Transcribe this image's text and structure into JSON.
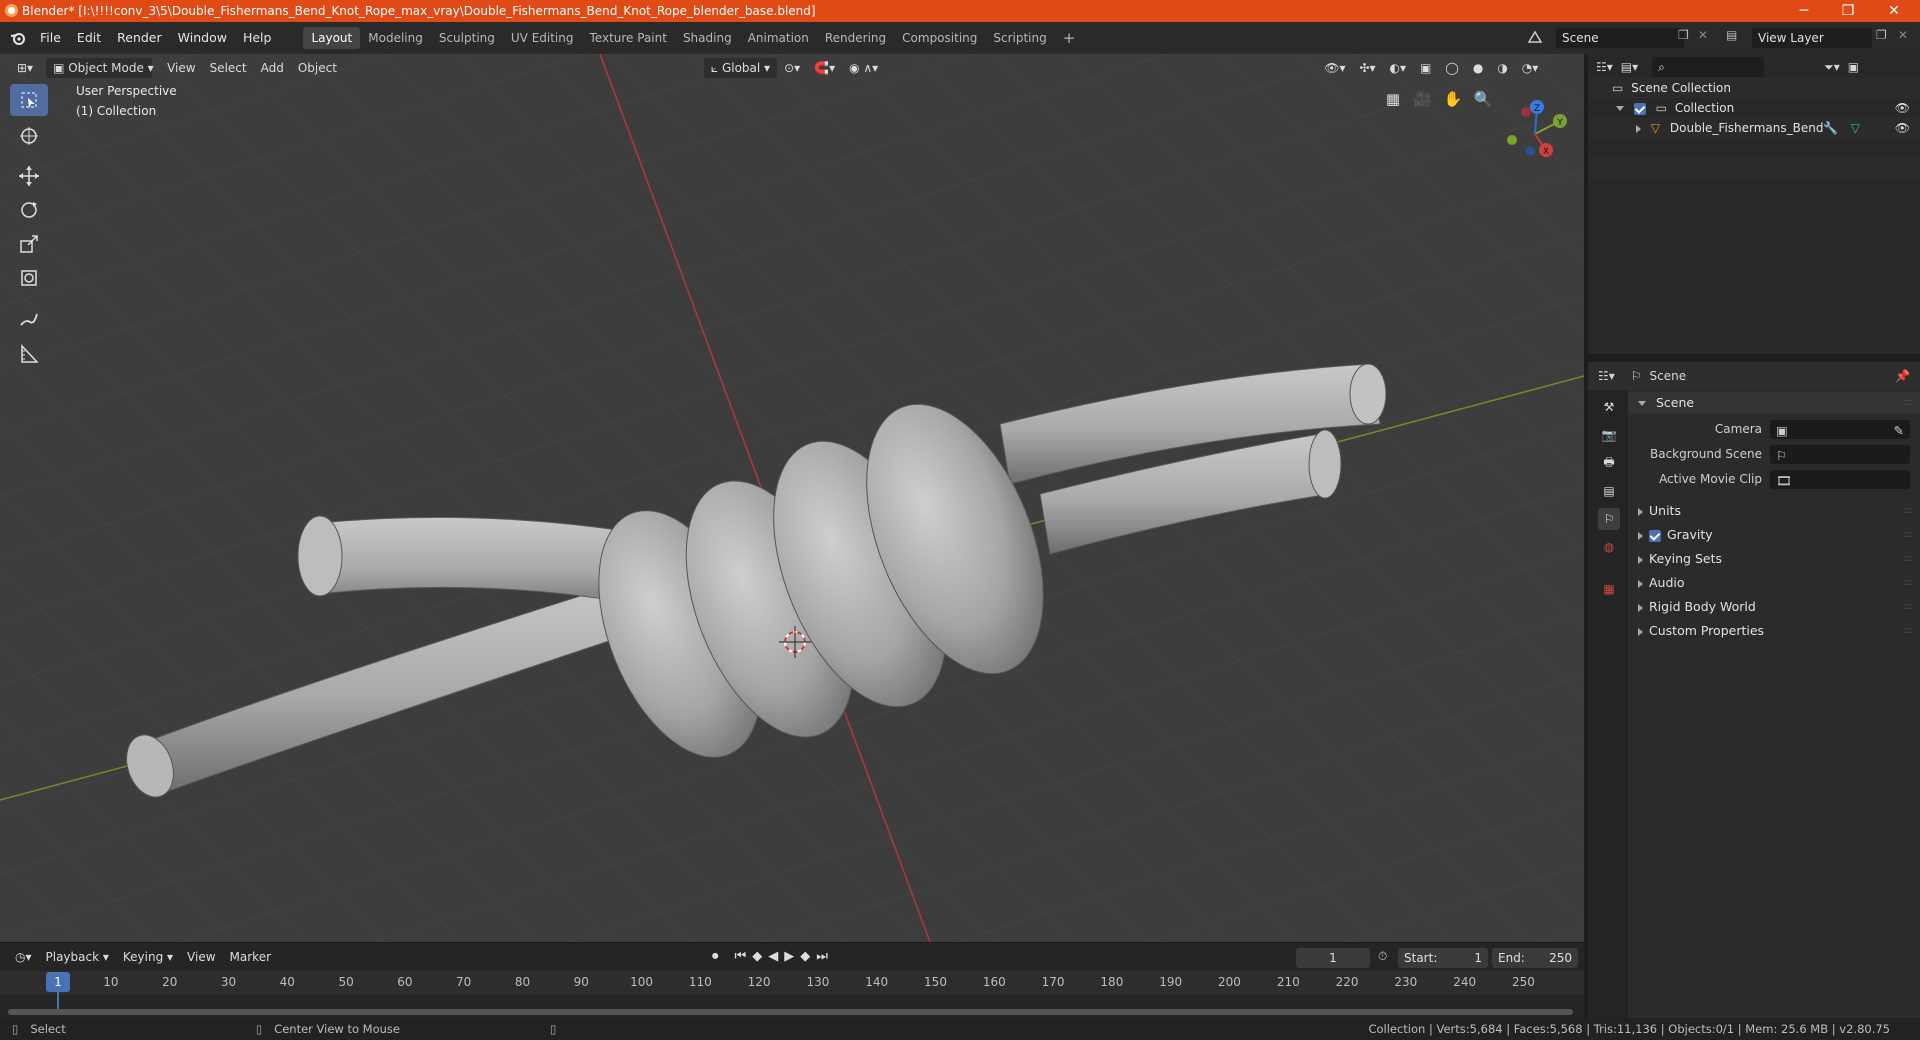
{
  "titlebar": {
    "title": "Blender* [I:\\!!!!conv_3\\5\\Double_Fishermans_Bend_Knot_Rope_max_vray\\Double_Fishermans_Bend_Knot_Rope_blender_base.blend]",
    "minimize": "─",
    "restore": "❐",
    "close": "✕"
  },
  "menu": [
    "File",
    "Edit",
    "Render",
    "Window",
    "Help"
  ],
  "workspaces": [
    {
      "label": "Layout",
      "active": true
    },
    {
      "label": "Modeling"
    },
    {
      "label": "Sculpting"
    },
    {
      "label": "UV Editing"
    },
    {
      "label": "Texture Paint"
    },
    {
      "label": "Shading"
    },
    {
      "label": "Animation"
    },
    {
      "label": "Rendering"
    },
    {
      "label": "Compositing"
    },
    {
      "label": "Scripting"
    }
  ],
  "add_workspace": "+",
  "scene_field": "Scene",
  "view_layer_field": "View Layer",
  "viewport": {
    "mode": "Object Mode",
    "menus": [
      "View",
      "Select",
      "Add",
      "Object"
    ],
    "transform_orientation": "Global",
    "overlay_line1": "User Perspective",
    "overlay_line2": "(1) Collection",
    "gizmo": {
      "x": "X",
      "y": "Y",
      "z": "Z"
    }
  },
  "tools": [
    "select-box-icon",
    "cursor-icon",
    "move-icon",
    "rotate-icon",
    "scale-icon",
    "transform-icon",
    "annotate-icon",
    "measure-icon"
  ],
  "outliner": {
    "root": "Scene Collection",
    "collection": "Collection",
    "object": "Double_Fishermans_Bend"
  },
  "properties": {
    "header": "Scene",
    "section": "Scene",
    "fields": [
      {
        "label": "Camera"
      },
      {
        "label": "Background Scene"
      },
      {
        "label": "Active Movie Clip"
      }
    ],
    "panels": [
      {
        "label": "Units"
      },
      {
        "label": "Gravity",
        "checkbox": true
      },
      {
        "label": "Keying Sets"
      },
      {
        "label": "Audio"
      },
      {
        "label": "Rigid Body World"
      },
      {
        "label": "Custom Properties"
      }
    ]
  },
  "timeline": {
    "menus": [
      "Playback",
      "Keying",
      "View",
      "Marker"
    ],
    "current_frame": "1",
    "start_label": "Start:",
    "start": "1",
    "end_label": "End:",
    "end": "250",
    "ticks": [
      "1",
      "10",
      "20",
      "30",
      "40",
      "50",
      "60",
      "70",
      "80",
      "90",
      "100",
      "110",
      "120",
      "130",
      "140",
      "150",
      "160",
      "170",
      "180",
      "190",
      "200",
      "210",
      "220",
      "230",
      "240",
      "250"
    ]
  },
  "statusbar": {
    "select": "Select",
    "center_view": "Center View to Mouse",
    "stats": "Collection | Verts:5,684 | Faces:5,568 | Tris:11,136 | Objects:0/1 | Mem: 25.6 MB | v2.80.75"
  },
  "colors": {
    "titlebar": "#e04a16",
    "accent": "#4772b3",
    "x_axis": "#c0392b",
    "y_axis": "#7aa32e",
    "z_axis": "#2f6cd0"
  }
}
